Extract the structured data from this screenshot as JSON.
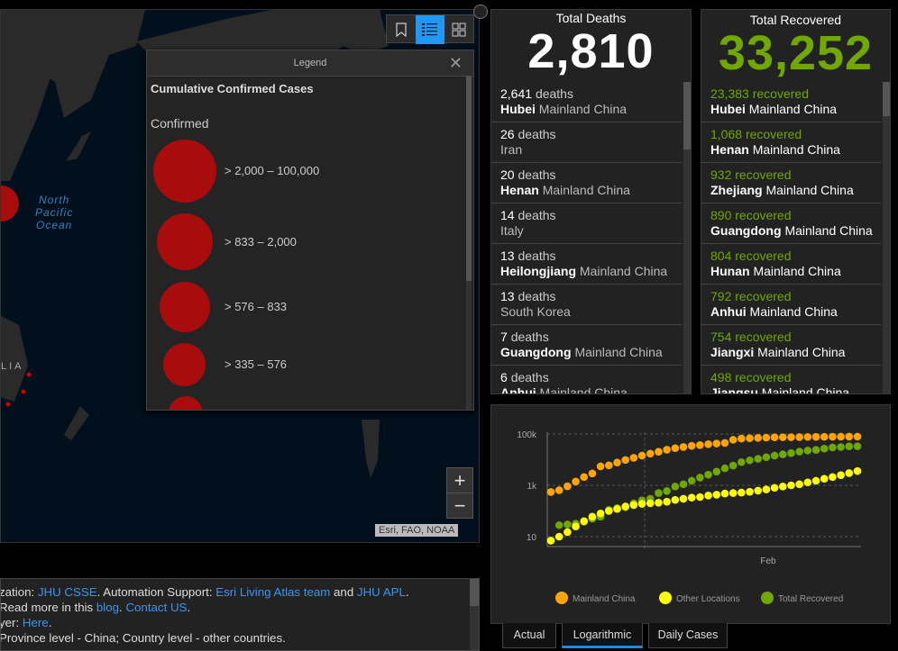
{
  "map": {
    "ocean_label": [
      "North",
      "Pacific",
      "Ocean"
    ],
    "country_label": "LIA",
    "attribution": "Esri, FAO, NOAA",
    "zoom_in": "+",
    "zoom_out": "−"
  },
  "legend": {
    "header": "Legend",
    "title": "Cumulative Confirmed Cases",
    "field": "Confirmed",
    "classes": [
      "> 2,000 – 100,000",
      "> 833 – 2,000",
      "> 576 – 833",
      "> 335 – 576"
    ]
  },
  "info": {
    "line1": {
      "pre": "zation: ",
      "l1": "JHU CSSE",
      "mid": ". Automation Support: ",
      "l2": "Esri Living Atlas team",
      "and": " and ",
      "l3": "JHU APL",
      "post": "."
    },
    "line2": {
      "pre": "Read more in this ",
      "l1": "blog",
      "mid": ". ",
      "l2": "Contact US",
      "post": "."
    },
    "line3": {
      "pre": "yer: ",
      "l1": "Here",
      "post": "."
    },
    "line4": "Province level - China; Country level - other countries."
  },
  "deaths": {
    "title": "Total Deaths",
    "total": "2,810",
    "items": [
      {
        "count": "2,641",
        "unit": "deaths",
        "province": "Hubei",
        "country": "Mainland China"
      },
      {
        "count": "26",
        "unit": "deaths",
        "province": "",
        "country": "Iran"
      },
      {
        "count": "20",
        "unit": "deaths",
        "province": "Henan",
        "country": "Mainland China"
      },
      {
        "count": "14",
        "unit": "deaths",
        "province": "",
        "country": "Italy"
      },
      {
        "count": "13",
        "unit": "deaths",
        "province": "Heilongjiang",
        "country": "Mainland China"
      },
      {
        "count": "13",
        "unit": "deaths",
        "province": "",
        "country": "South Korea"
      },
      {
        "count": "7",
        "unit": "deaths",
        "province": "Guangdong",
        "country": "Mainland China"
      },
      {
        "count": "6",
        "unit": "deaths",
        "province": "Anhui",
        "country": "Mainland China"
      }
    ]
  },
  "recovered": {
    "title": "Total Recovered",
    "total": "33,252",
    "items": [
      {
        "count": "23,383",
        "unit": "recovered",
        "province": "Hubei",
        "country": "Mainland China"
      },
      {
        "count": "1,068",
        "unit": "recovered",
        "province": "Henan",
        "country": "Mainland China"
      },
      {
        "count": "932",
        "unit": "recovered",
        "province": "Zhejiang",
        "country": "Mainland China"
      },
      {
        "count": "890",
        "unit": "recovered",
        "province": "Guangdong",
        "country": "Mainland China"
      },
      {
        "count": "804",
        "unit": "recovered",
        "province": "Hunan",
        "country": "Mainland China"
      },
      {
        "count": "792",
        "unit": "recovered",
        "province": "Anhui",
        "country": "Mainland China"
      },
      {
        "count": "754",
        "unit": "recovered",
        "province": "Jiangxi",
        "country": "Mainland China"
      },
      {
        "count": "498",
        "unit": "recovered",
        "province": "Jiangsu",
        "country": "Mainland China"
      }
    ]
  },
  "colors": {
    "green": "#70a800",
    "orange": "#ffa500",
    "yellow": "#ffff00",
    "red": "#a80c0c",
    "accent": "#2196f3"
  },
  "tabs": [
    "Actual",
    "Logarithmic",
    "Daily Cases"
  ],
  "chart_data": {
    "type": "scatter",
    "yscale": "log",
    "yticks": [
      10,
      1000,
      100000
    ],
    "ytick_labels": [
      "10",
      "1k",
      "100k"
    ],
    "xtick_labels": [
      "Feb"
    ],
    "ylim": [
      5,
      150000
    ],
    "grid": true,
    "legend_position": "bottom",
    "series": [
      {
        "name": "Mainland China",
        "color": "#ffa500",
        "values": [
          548,
          643,
          920,
          1400,
          2100,
          2900,
          5500,
          6000,
          7700,
          9700,
          11800,
          14400,
          17200,
          20400,
          24400,
          28000,
          31200,
          34500,
          37100,
          40200,
          42700,
          44700,
          59800,
          66300,
          68300,
          70400,
          72400,
          74200,
          74600,
          75000,
          75500,
          76900,
          77200,
          77700,
          78100,
          78600,
          78900,
          79300
        ]
      },
      {
        "name": "Other Locations",
        "color": "#ffff00",
        "values": [
          7,
          10,
          15,
          25,
          40,
          60,
          80,
          100,
          120,
          150,
          170,
          190,
          200,
          210,
          230,
          270,
          300,
          330,
          350,
          400,
          430,
          480,
          500,
          520,
          560,
          620,
          690,
          800,
          900,
          1000,
          1100,
          1300,
          1500,
          1800,
          2100,
          2500,
          3000,
          3600
        ]
      },
      {
        "name": "Total Recovered",
        "color": "#70a800",
        "values": [
          null,
          28,
          30,
          32,
          38,
          50,
          60,
          110,
          130,
          140,
          200,
          260,
          300,
          500,
          600,
          900,
          1100,
          1500,
          2000,
          2600,
          3400,
          4600,
          5900,
          8000,
          9400,
          10800,
          12500,
          14400,
          16100,
          18000,
          20600,
          22700,
          24000,
          27000,
          30000,
          31000,
          33000,
          33252
        ]
      }
    ]
  }
}
